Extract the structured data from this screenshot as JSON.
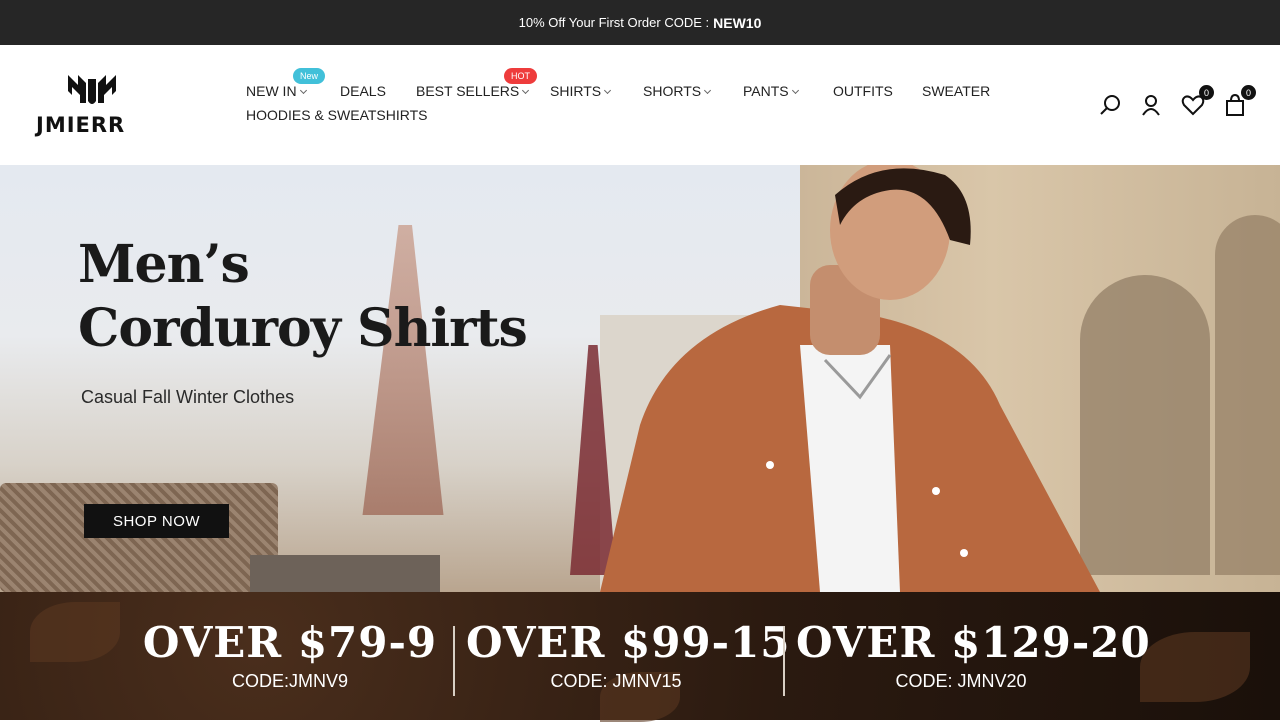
{
  "announcement": {
    "text": "10% Off Your First Order CODE :",
    "code": "NEW10"
  },
  "brand": {
    "name": "JMIERR"
  },
  "nav": {
    "items": [
      {
        "label": "NEW IN",
        "badge": "New"
      },
      {
        "label": "DEALS"
      },
      {
        "label": "BEST SELLERS",
        "badge": "HOT"
      },
      {
        "label": "SHIRTS"
      },
      {
        "label": "SHORTS"
      },
      {
        "label": "PANTS"
      },
      {
        "label": "OUTFITS"
      },
      {
        "label": "SWEATER"
      },
      {
        "label": "HOODIES & SWEATSHIRTS"
      }
    ]
  },
  "header_icons": {
    "wishlist_count": "0",
    "cart_count": "0"
  },
  "hero": {
    "title_line1": "Men’s",
    "title_line2": "Corduroy Shirts",
    "subtitle": "Casual Fall Winter Clothes",
    "cta": "SHOP NOW"
  },
  "promos": [
    {
      "offer": "OVER $79-9",
      "code": "CODE:JMNV9"
    },
    {
      "offer": "OVER $99-15",
      "code": "CODE: JMNV15"
    },
    {
      "offer": "OVER $129-20",
      "code": "CODE: JMNV20"
    }
  ],
  "colors": {
    "topbar": "#262626",
    "badge_new": "#41c0d9",
    "badge_hot": "#ee3c3c",
    "cta_bg": "#111111"
  }
}
